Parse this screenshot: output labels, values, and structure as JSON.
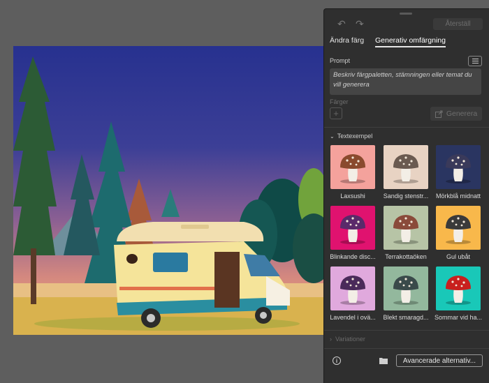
{
  "panel": {
    "reset_label": "Återställ",
    "tabs": [
      {
        "label": "Ändra färg"
      },
      {
        "label": "Generativ omfärgning"
      }
    ],
    "prompt": {
      "label": "Prompt",
      "placeholder": "Beskriv färgpaletten, stämningen eller temat du vill generera"
    },
    "colors_label": "Färger",
    "generate_label": "Generera",
    "samples": {
      "header": "Textexempel",
      "items": [
        {
          "label": "Laxsushi",
          "bg": "#f4a29c"
        },
        {
          "label": "Sandig stenstr...",
          "bg": "#e8d3c3"
        },
        {
          "label": "Mörkblå midnatt",
          "bg": "#2a3561"
        },
        {
          "label": "Blinkande disc...",
          "bg": "#e0126f"
        },
        {
          "label": "Terrakottaöken",
          "bg": "#b7c4a6"
        },
        {
          "label": "Gul ubåt",
          "bg": "#f8b84b"
        },
        {
          "label": "Lavendel i ovä...",
          "bg": "#e0a9dd"
        },
        {
          "label": "Blekt smaragd...",
          "bg": "#93b89d"
        },
        {
          "label": "Sommar vid ha...",
          "bg": "#19c8b8"
        }
      ]
    },
    "variations_label": "Variationer",
    "advanced_label": "Avancerade alternativ..."
  }
}
